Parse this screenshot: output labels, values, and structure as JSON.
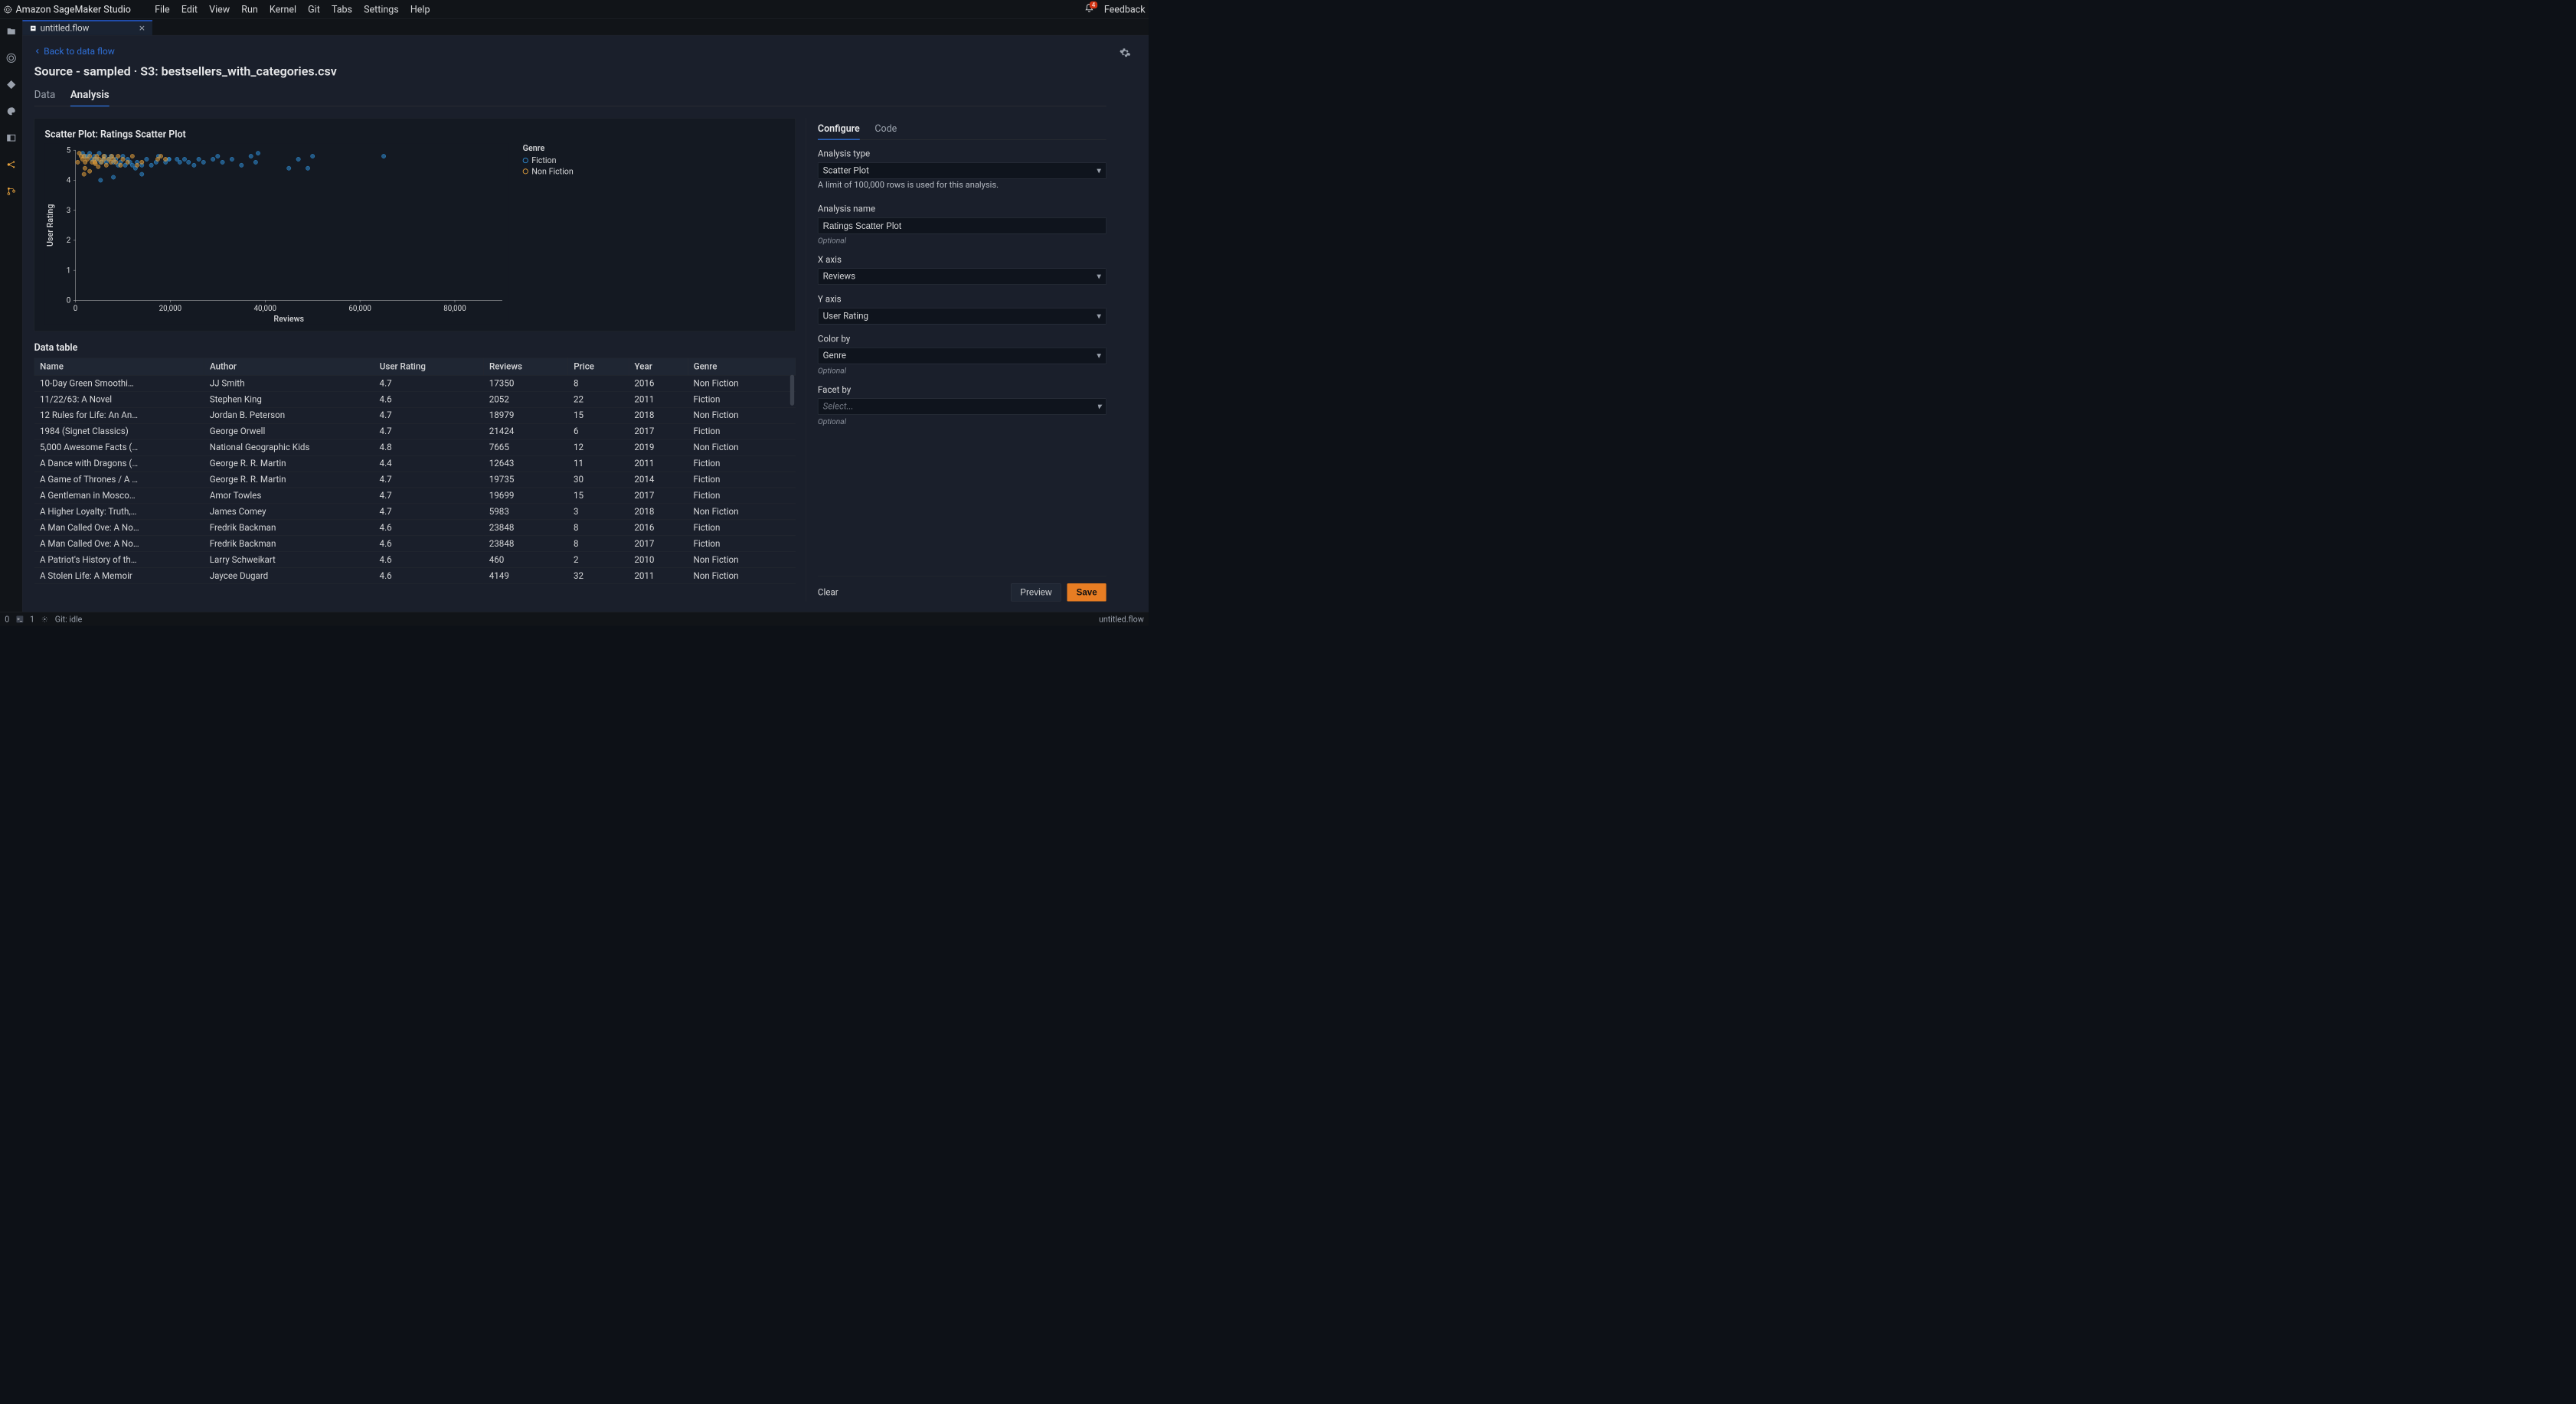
{
  "brand": "Amazon SageMaker Studio",
  "menus": [
    "File",
    "Edit",
    "View",
    "Run",
    "Kernel",
    "Git",
    "Tabs",
    "Settings",
    "Help"
  ],
  "notif_count": "4",
  "feedback": "Feedback",
  "tab": {
    "title": "untitled.flow"
  },
  "crumb": "Back to data flow",
  "page_title": "Source - sampled · S3: bestsellers_with_categories.csv",
  "subtabs": {
    "data": "Data",
    "analysis": "Analysis"
  },
  "chart": {
    "title_prefix": "Scatter Plot: ",
    "name": "Ratings Scatter Plot",
    "legend_title": "Genre",
    "legend_items": [
      "Fiction",
      "Non Fiction"
    ],
    "legend_colors": [
      "#2f8ed6",
      "#e8a33d"
    ]
  },
  "chart_data": {
    "type": "scatter",
    "xlabel": "Reviews",
    "ylabel": "User Rating",
    "xlim": [
      0,
      90000
    ],
    "ylim": [
      0,
      5
    ],
    "xticks": [
      0,
      20000,
      40000,
      60000,
      80000
    ],
    "yticks": [
      0,
      1,
      2,
      3,
      4,
      5
    ],
    "series": [
      {
        "name": "Fiction",
        "color": "#2f8ed6",
        "points": [
          [
            1500,
            4.9
          ],
          [
            2100,
            4.8
          ],
          [
            2500,
            4.8
          ],
          [
            3000,
            4.9
          ],
          [
            3500,
            4.7
          ],
          [
            4000,
            4.8
          ],
          [
            4500,
            4.7
          ],
          [
            5000,
            4.9
          ],
          [
            5300,
            4.6
          ],
          [
            5900,
            4.7
          ],
          [
            6200,
            4.8
          ],
          [
            6500,
            4.6
          ],
          [
            7000,
            4.7
          ],
          [
            7500,
            4.8
          ],
          [
            8000,
            4.6
          ],
          [
            8500,
            4.7
          ],
          [
            9000,
            4.5
          ],
          [
            9500,
            4.6
          ],
          [
            10000,
            4.8
          ],
          [
            10500,
            4.5
          ],
          [
            11000,
            4.7
          ],
          [
            11500,
            4.6
          ],
          [
            12000,
            4.5
          ],
          [
            12643,
            4.4
          ],
          [
            13000,
            4.6
          ],
          [
            14000,
            4.5
          ],
          [
            15000,
            4.7
          ],
          [
            16000,
            4.5
          ],
          [
            17000,
            4.6
          ],
          [
            17500,
            4.8
          ],
          [
            19000,
            4.6
          ],
          [
            19735,
            4.7
          ],
          [
            19699,
            4.7
          ],
          [
            21424,
            4.7
          ],
          [
            22000,
            4.6
          ],
          [
            23000,
            4.7
          ],
          [
            23848,
            4.6
          ],
          [
            25000,
            4.5
          ],
          [
            26000,
            4.7
          ],
          [
            27000,
            4.6
          ],
          [
            29000,
            4.7
          ],
          [
            30000,
            4.8
          ],
          [
            31000,
            4.6
          ],
          [
            33000,
            4.7
          ],
          [
            35000,
            4.5
          ],
          [
            37000,
            4.8
          ],
          [
            38000,
            4.6
          ],
          [
            38500,
            4.9
          ],
          [
            45000,
            4.4
          ],
          [
            47000,
            4.7
          ],
          [
            49000,
            4.4
          ],
          [
            50000,
            4.8
          ],
          [
            65000,
            4.8
          ],
          [
            8000,
            4.1
          ],
          [
            14000,
            4.2
          ],
          [
            5300,
            4.0
          ]
        ]
      },
      {
        "name": "Non Fiction",
        "color": "#e8a33d",
        "points": [
          [
            800,
            4.9
          ],
          [
            1200,
            4.8
          ],
          [
            1500,
            4.7
          ],
          [
            1800,
            4.8
          ],
          [
            2052,
            4.6
          ],
          [
            2500,
            4.7
          ],
          [
            3000,
            4.8
          ],
          [
            3500,
            4.6
          ],
          [
            4000,
            4.7
          ],
          [
            4149,
            4.6
          ],
          [
            4500,
            4.8
          ],
          [
            5000,
            4.7
          ],
          [
            5500,
            4.6
          ],
          [
            5983,
            4.7
          ],
          [
            6000,
            4.8
          ],
          [
            6500,
            4.5
          ],
          [
            7000,
            4.7
          ],
          [
            7500,
            4.6
          ],
          [
            7665,
            4.8
          ],
          [
            8000,
            4.7
          ],
          [
            8500,
            4.6
          ],
          [
            9000,
            4.8
          ],
          [
            9500,
            4.5
          ],
          [
            10000,
            4.7
          ],
          [
            11000,
            4.6
          ],
          [
            12000,
            4.8
          ],
          [
            13000,
            4.5
          ],
          [
            14000,
            4.6
          ],
          [
            17350,
            4.7
          ],
          [
            18000,
            4.8
          ],
          [
            18979,
            4.7
          ],
          [
            460,
            4.6
          ],
          [
            2000,
            4.4
          ],
          [
            3000,
            4.3
          ],
          [
            1800,
            4.2
          ],
          [
            4200,
            4.55
          ],
          [
            4800,
            4.45
          ]
        ]
      }
    ]
  },
  "data_table": {
    "title": "Data table",
    "cols": [
      "Name",
      "Author",
      "User Rating",
      "Reviews",
      "Price",
      "Year",
      "Genre"
    ],
    "rows": [
      [
        "10-Day Green Smoothi…",
        "JJ Smith",
        "4.7",
        "17350",
        "8",
        "2016",
        "Non Fiction"
      ],
      [
        "11/22/63: A Novel",
        "Stephen King",
        "4.6",
        "2052",
        "22",
        "2011",
        "Fiction"
      ],
      [
        "12 Rules for Life: An An…",
        "Jordan B. Peterson",
        "4.7",
        "18979",
        "15",
        "2018",
        "Non Fiction"
      ],
      [
        "1984 (Signet Classics)",
        "George Orwell",
        "4.7",
        "21424",
        "6",
        "2017",
        "Fiction"
      ],
      [
        "5,000 Awesome Facts (…",
        "National Geographic Kids",
        "4.8",
        "7665",
        "12",
        "2019",
        "Non Fiction"
      ],
      [
        "A Dance with Dragons (…",
        "George R. R. Martin",
        "4.4",
        "12643",
        "11",
        "2011",
        "Fiction"
      ],
      [
        "A Game of Thrones / A …",
        "George R. R. Martin",
        "4.7",
        "19735",
        "30",
        "2014",
        "Fiction"
      ],
      [
        "A Gentleman in Mosco…",
        "Amor Towles",
        "4.7",
        "19699",
        "15",
        "2017",
        "Fiction"
      ],
      [
        "A Higher Loyalty: Truth,…",
        "James Comey",
        "4.7",
        "5983",
        "3",
        "2018",
        "Non Fiction"
      ],
      [
        "A Man Called Ove: A No…",
        "Fredrik Backman",
        "4.6",
        "23848",
        "8",
        "2016",
        "Fiction"
      ],
      [
        "A Man Called Ove: A No…",
        "Fredrik Backman",
        "4.6",
        "23848",
        "8",
        "2017",
        "Fiction"
      ],
      [
        "A Patriot's History of th…",
        "Larry Schweikart",
        "4.6",
        "460",
        "2",
        "2010",
        "Non Fiction"
      ],
      [
        "A Stolen Life: A Memoir",
        "Jaycee Dugard",
        "4.6",
        "4149",
        "32",
        "2011",
        "Non Fiction"
      ]
    ]
  },
  "config": {
    "tabs": {
      "configure": "Configure",
      "code": "Code"
    },
    "analysis_type_label": "Analysis type",
    "analysis_type": "Scatter Plot",
    "limit_hint": "A limit of 100,000 rows is used for this analysis.",
    "name_label": "Analysis name",
    "name_value": "Ratings Scatter Plot",
    "optional": "Optional",
    "x_label": "X axis",
    "x_value": "Reviews",
    "y_label": "Y axis",
    "y_value": "User Rating",
    "color_label": "Color by",
    "color_value": "Genre",
    "facet_label": "Facet by",
    "facet_placeholder": "Select...",
    "clear": "Clear",
    "preview": "Preview",
    "save": "Save"
  },
  "status": {
    "zero": "0",
    "one": "1",
    "git": "Git: idle",
    "file": "untitled.flow"
  }
}
